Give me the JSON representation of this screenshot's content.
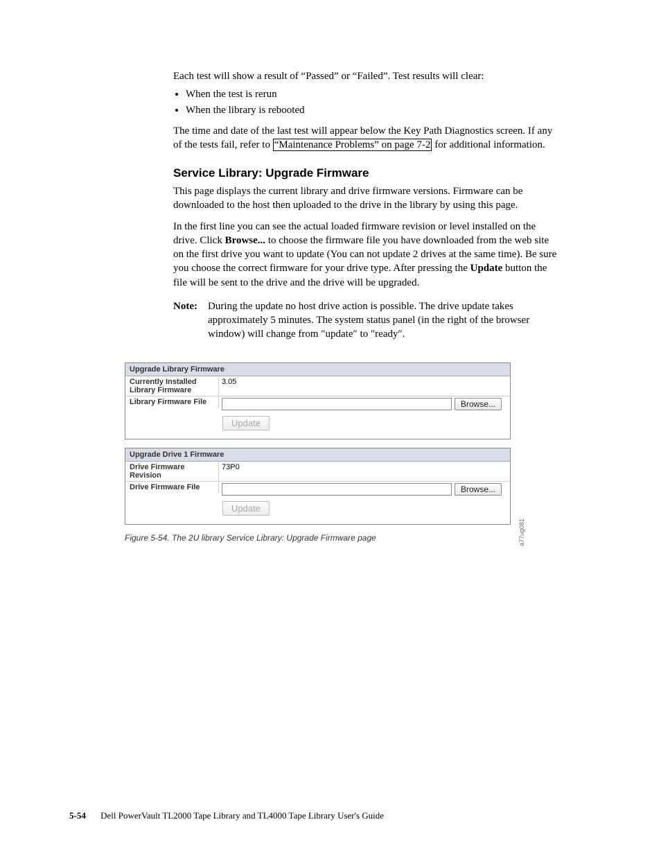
{
  "body": {
    "intro": "Each test will show a result of “Passed” or “Failed”. Test results will clear:",
    "bullet1": "When the test is rerun",
    "bullet2": "When the library is rebooted",
    "para2a": "The time and date of the last test will appear below the Key Path Diagnostics screen. If any of the tests fail, refer to ",
    "para2link": "“Maintenance Problems” on page 7-2",
    "para2b": " for additional information.",
    "heading": "Service Library: Upgrade Firmware",
    "para3": "This page displays the current library and drive firmware versions. Firmware can be downloaded to the host then uploaded to the drive in the library by using this page.",
    "para4a": "In the first line you can see the actual loaded firmware revision or level installed on the drive. Click ",
    "para4b": "Browse...",
    "para4c": " to choose the firmware file you have downloaded from the web site on the first drive you want to update (You can not update 2 drives at the same time). Be sure you choose the correct firmware for your drive type. After pressing the ",
    "para4d": "Update",
    "para4e": " button the file will be sent to the drive and the drive will be upgraded.",
    "noteLabel": "Note:",
    "noteText": "During the update no host drive action is possible. The drive update takes approximately 5 minutes. The system status panel (in the right of the browser window) will change from ″update″ to ″ready″."
  },
  "figure": {
    "panel1": {
      "title": "Upgrade Library Firmware",
      "row1label": "Currently Installed Library Firmware",
      "row1value": "3.05",
      "row2label": "Library Firmware File",
      "browse": "Browse...",
      "update": "Update"
    },
    "panel2": {
      "title": "Upgrade Drive 1 Firmware",
      "row1label": "Drive Firmware Revision",
      "row1value": "73P0",
      "row2label": "Drive Firmware File",
      "browse": "Browse...",
      "update": "Update"
    },
    "sidelabel": "a77ug081",
    "caption": "Figure 5-54. The 2U library Service Library: Upgrade Firmware page"
  },
  "footer": {
    "page": "5-54",
    "title": "Dell PowerVault TL2000 Tape Library and TL4000 Tape Library User's Guide"
  }
}
